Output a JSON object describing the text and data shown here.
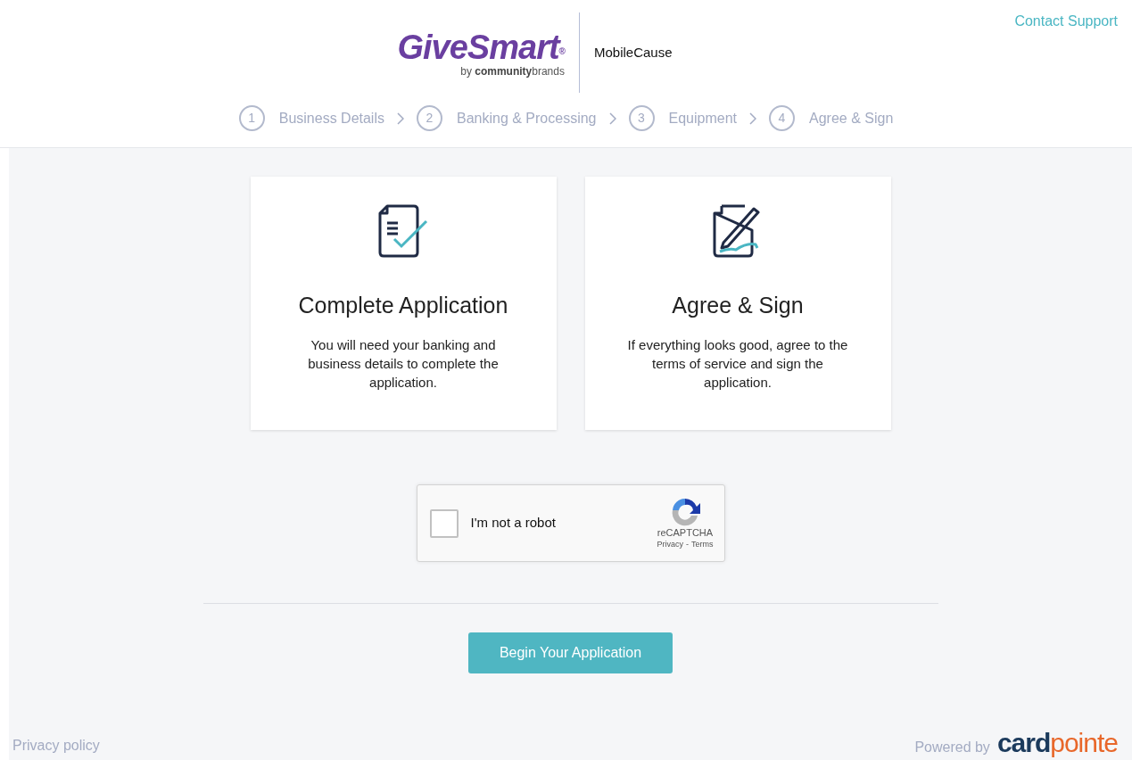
{
  "header": {
    "logo": {
      "name": "GiveSmart",
      "mark": "®",
      "by": "by",
      "community": "community",
      "brands": "brands"
    },
    "partner": "MobileCause",
    "contact_link": "Contact Support"
  },
  "steps": [
    {
      "number": "1",
      "label": "Business Details"
    },
    {
      "number": "2",
      "label": "Banking & Processing"
    },
    {
      "number": "3",
      "label": "Equipment"
    },
    {
      "number": "4",
      "label": "Agree & Sign"
    }
  ],
  "cards": [
    {
      "kind": "application",
      "title": "Complete Application",
      "text": "You will need your banking and business details to complete the application."
    },
    {
      "kind": "sign",
      "title": "Agree & Sign",
      "text": "If everything looks good, agree to the terms of service and sign the application."
    }
  ],
  "captcha": {
    "label": "I'm not a robot",
    "checked": false,
    "brand": "reCAPTCHA",
    "privacy": "Privacy",
    "separator": "-",
    "terms": "Terms"
  },
  "begin_button": "Begin Your Application",
  "footer": {
    "privacy_link": "Privacy policy",
    "powered_by": "Powered by",
    "brand_first": "card",
    "brand_second": "pointe"
  }
}
